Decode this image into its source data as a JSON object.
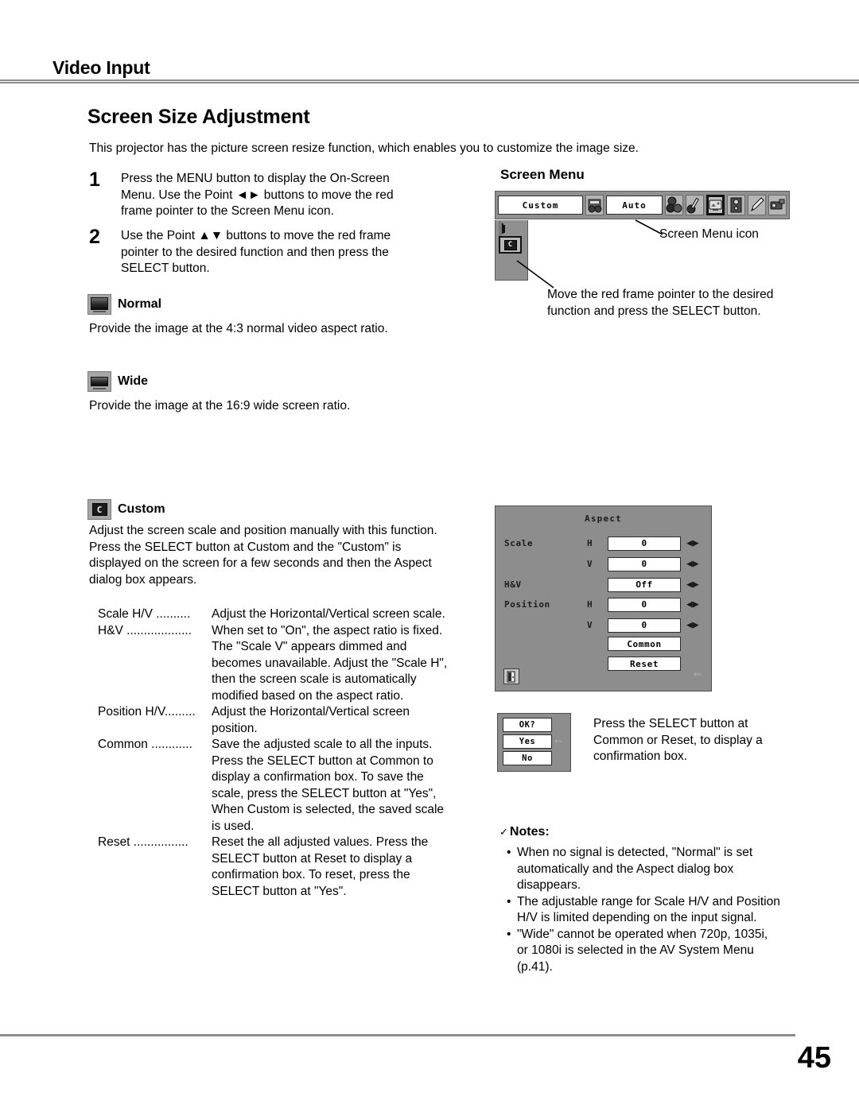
{
  "header": {
    "title": "Video Input"
  },
  "page_title": "Screen Size Adjustment",
  "intro": "This projector has the picture screen resize function, which enables you to customize the image size.",
  "steps": [
    {
      "num": "1",
      "text": "Press the MENU button to display the On-Screen Menu. Use the Point ◄► buttons to move the red frame pointer to the Screen Menu icon."
    },
    {
      "num": "2",
      "text": "Use the Point ▲▼ buttons to move the red frame pointer to the desired function and then press the SELECT button."
    }
  ],
  "options": [
    {
      "icon": "normal-screen-icon",
      "label": "Normal",
      "desc": "Provide the image at the 4:3 normal video aspect ratio."
    },
    {
      "icon": "wide-screen-icon",
      "label": "Wide",
      "desc": "Provide the image at the 16:9 wide screen ratio."
    },
    {
      "icon": "custom-screen-icon",
      "label": "Custom",
      "desc": "Adjust the screen scale and position manually with this function.\nPress the SELECT button at Custom and the \"Custom\" is displayed on the screen for a few seconds and then the Aspect dialog box appears."
    }
  ],
  "definitions": [
    {
      "term": "Scale H/V ..........",
      "desc": "Adjust the Horizontal/Vertical screen scale."
    },
    {
      "term": "H&V ...................",
      "desc": "When set to \"On\", the aspect ratio is fixed. The \"Scale V\" appears dimmed and becomes unavailable. Adjust the \"Scale H\", then the screen scale is automatically modified based on the aspect ratio."
    },
    {
      "term": "Position H/V.........",
      "desc": "Adjust the Horizontal/Vertical screen position."
    },
    {
      "term": "Common ............",
      "desc": "Save the adjusted scale to all the inputs. Press the SELECT button at Common to display a confirmation box. To save the scale, press the SELECT button at \"Yes\", When Custom is selected, the saved scale is used."
    },
    {
      "term": "Reset ................",
      "desc": "Reset the all adjusted values. Press the SELECT button at Reset to display a confirmation box. To reset, press the SELECT button at \"Yes\"."
    }
  ],
  "screen_menu": {
    "title": "Screen Menu",
    "osd_bar": {
      "input_value": "Custom",
      "system_value": "Auto",
      "icons": [
        "input-source-icon",
        "color-adjust-icon",
        "image-adjust-icon",
        "screen-menu-icon",
        "sound-icon",
        "setting-pen-icon",
        "projector-info-icon"
      ]
    },
    "side_icons": [
      "normal-screen-icon",
      "wide-screen-icon",
      "custom-screen-icon"
    ],
    "callout_icon_label": "Screen Menu icon",
    "callout_pointer_text": "Move the red frame pointer to the desired function and press the SELECT button."
  },
  "aspect_dialog": {
    "title": "Aspect",
    "rows": [
      {
        "label": "Scale",
        "hv": "H",
        "value": "0"
      },
      {
        "label": "",
        "hv": "V",
        "value": "0"
      },
      {
        "label": "H&V",
        "hv": "",
        "value": "Off"
      },
      {
        "label": "Position",
        "hv": "H",
        "value": "0"
      },
      {
        "label": "",
        "hv": "V",
        "value": "0"
      }
    ],
    "buttons": [
      {
        "label": "Common"
      },
      {
        "label": "Reset"
      }
    ],
    "exit_icon": "exit-door-icon",
    "back_arrow": "←"
  },
  "confirm_box": {
    "items": [
      {
        "label": "OK?",
        "name": "confirm-prompt"
      },
      {
        "label": "Yes",
        "name": "confirm-yes"
      },
      {
        "label": "No",
        "name": "confirm-no"
      }
    ],
    "pointer": "←",
    "caption": "Press the SELECT button at Common or Reset, to display a confirmation box."
  },
  "notes": {
    "title": "Notes:",
    "check": "✓",
    "bullet": "•",
    "items": [
      "When no signal is detected, \"Normal\" is set automatically and the Aspect dialog box disappears.",
      "The adjustable range for Scale H/V and Position H/V is limited depending on the input signal.",
      "\"Wide\" cannot be operated when 720p, 1035i, or 1080i is selected in the AV System Menu (p.41)."
    ]
  },
  "footer": {
    "page_number": "45"
  }
}
